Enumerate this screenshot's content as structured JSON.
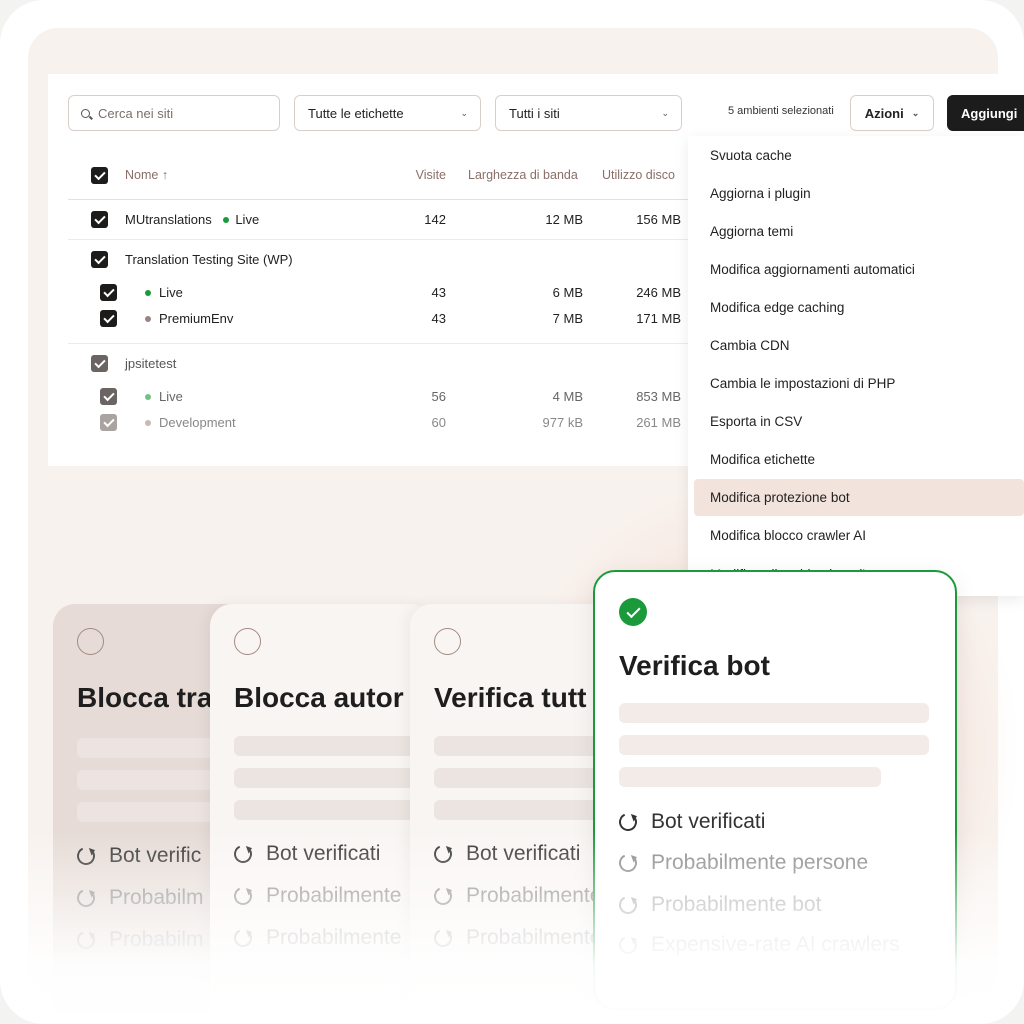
{
  "toolbar": {
    "search_placeholder": "Cerca nei siti",
    "tags_select": "Tutte le etichette",
    "sites_select": "Tutti i siti",
    "selected_count": "5 ambienti selezionati",
    "actions_label": "Azioni",
    "add_label": "Aggiungi"
  },
  "table": {
    "headers": {
      "name": "Nome ↑",
      "visits": "Visite",
      "bandwidth": "Larghezza di banda",
      "disk": "Utilizzo disco"
    },
    "rows": [
      {
        "site": "MUtranslations",
        "env": "Live",
        "visits": "142",
        "bandwidth": "12 MB",
        "disk": "156 MB"
      },
      {
        "site": "Translation Testing Site (WP)"
      },
      {
        "env": "Live",
        "visits": "43",
        "bandwidth": "6 MB",
        "disk": "246 MB"
      },
      {
        "env": "PremiumEnv",
        "visits": "43",
        "bandwidth": "7 MB",
        "disk": "171 MB"
      },
      {
        "site": "jpsitetest"
      },
      {
        "env": "Live",
        "visits": "56",
        "bandwidth": "4 MB",
        "disk": "853 MB"
      },
      {
        "env": "Development",
        "visits": "60",
        "bandwidth": "977 kB",
        "disk": "261 MB"
      }
    ]
  },
  "menu": {
    "items": [
      "Svuota cache",
      "Aggiorna i plugin",
      "Aggiorna temi",
      "Modifica aggiornamenti automatici",
      "Modifica edge caching",
      "Cambia CDN",
      "Cambia le impostazioni di PHP",
      "Esporta in CSV",
      "Modifica etichette",
      "Modifica protezione bot",
      "Modifica blocco crawler AI",
      "Modifica gli ambienti per l'a"
    ],
    "active_index": 9
  },
  "cards": [
    {
      "title": "Blocca tra",
      "options": [
        "Bot verific",
        "Probabilm",
        "Probabilm"
      ]
    },
    {
      "title": "Blocca autor",
      "options": [
        "Bot verificati",
        "Probabilmente",
        "Probabilmente"
      ]
    },
    {
      "title": "Verifica tutt",
      "options": [
        "Bot verificati",
        "Probabilmente",
        "Probabilmente"
      ]
    },
    {
      "title": "Verifica bot",
      "options": [
        "Bot verificati",
        "Probabilmente persone",
        "Probabilmente bot",
        "Expensive-rate AI crawlers"
      ],
      "selected": true
    }
  ],
  "colors": {
    "accent_green": "#1a9a3b",
    "active_menu": "#f2e3dd",
    "dark": "#1c1c1c"
  }
}
